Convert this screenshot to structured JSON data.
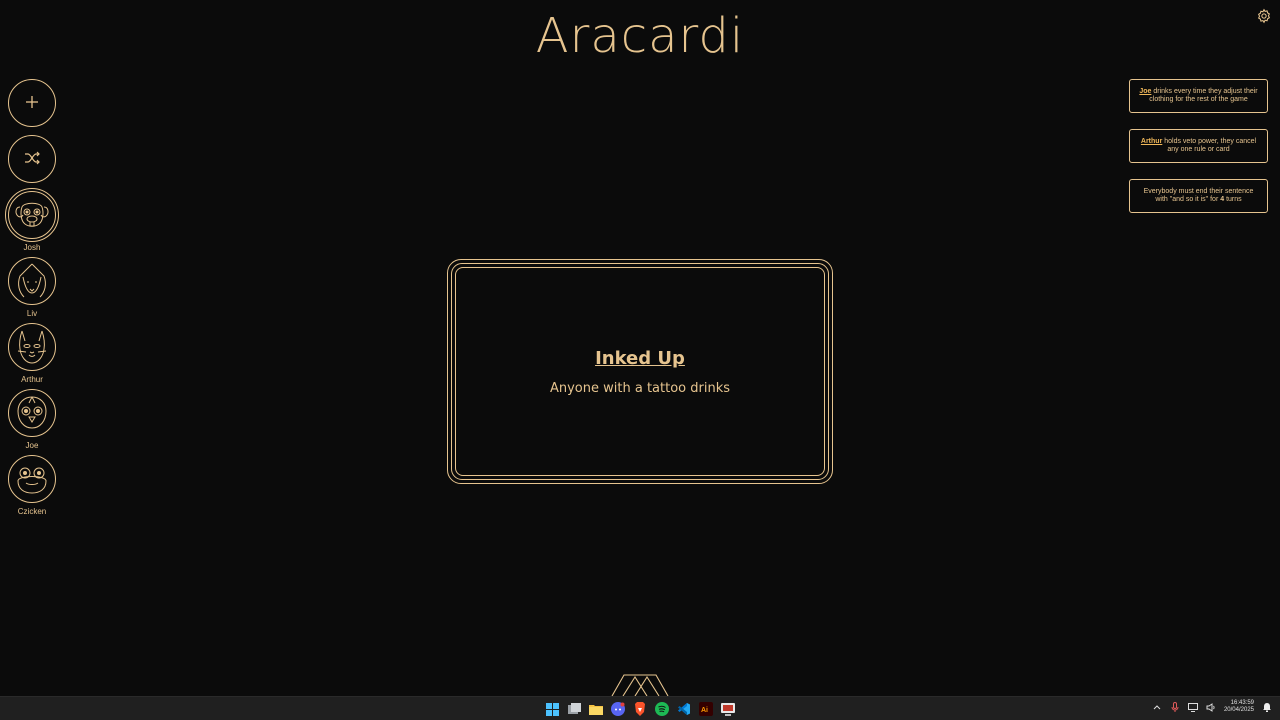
{
  "app": {
    "title": "Aracardi"
  },
  "sidebar": {
    "players": [
      {
        "name": "Josh",
        "avatar": "dog-icon",
        "active": true
      },
      {
        "name": "Liv",
        "avatar": "hooded-girl-icon",
        "active": false
      },
      {
        "name": "Arthur",
        "avatar": "cat-icon",
        "active": false
      },
      {
        "name": "Joe",
        "avatar": "bird-icon",
        "active": false
      },
      {
        "name": "Czicken",
        "avatar": "frog-icon",
        "active": false
      }
    ]
  },
  "rules": [
    {
      "player": "Joe",
      "text": " drinks every time they adjust their clothing for the rest of the game"
    },
    {
      "player": "Arthur",
      "text": " holds veto power, they cancel any one rule or card"
    },
    {
      "pre": "Everybody must end their sentence with \"and so it is\" for ",
      "count": "4",
      "post": " turns"
    }
  ],
  "card": {
    "title": "Inked Up",
    "text": "Anyone with a tattoo drinks"
  },
  "taskbar": {
    "apps": [
      "windows-start-icon",
      "task-view-icon",
      "file-explorer-icon",
      "discord-icon",
      "brave-icon",
      "spotify-icon",
      "vscode-icon",
      "illustrator-icon",
      "remote-desktop-icon"
    ],
    "time": "16:43:59",
    "date": "20/04/2025"
  },
  "colors": {
    "accent": "#e6c48f",
    "highlight": "#f0b85a",
    "background": "#0b0b0b",
    "taskbar": "#202020"
  }
}
